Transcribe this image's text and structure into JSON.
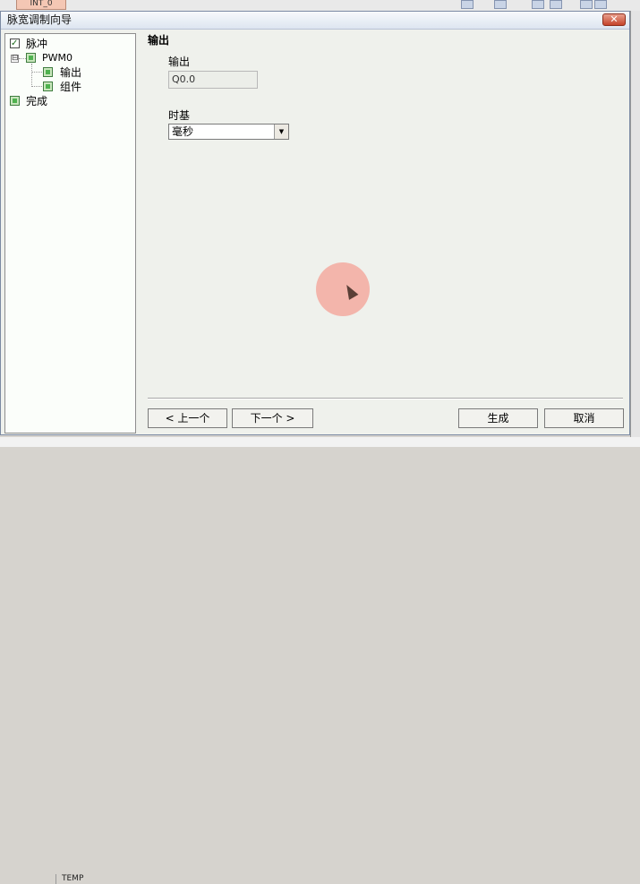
{
  "background": {
    "tab_label": "INT_0",
    "temp_label": "TEMP"
  },
  "dialog": {
    "title": "脉宽调制向导",
    "close_icon": "close-icon"
  },
  "tree": {
    "items": [
      {
        "label": "脉冲",
        "checked": true
      },
      {
        "label": "PWM0",
        "expander": "⊟"
      },
      {
        "label": "输出"
      },
      {
        "label": "组件"
      },
      {
        "label": "完成"
      }
    ]
  },
  "content": {
    "heading": "输出",
    "output_label": "输出",
    "output_value": "Q0.0",
    "timebase_label": "时基",
    "timebase_value": "毫秒"
  },
  "buttons": {
    "prev": "< 上一个",
    "next": "下一个 >",
    "generate": "生成",
    "cancel": "取消"
  },
  "colors": {
    "cursor_halo": "#f4a096",
    "close_button": "#c4432a"
  }
}
